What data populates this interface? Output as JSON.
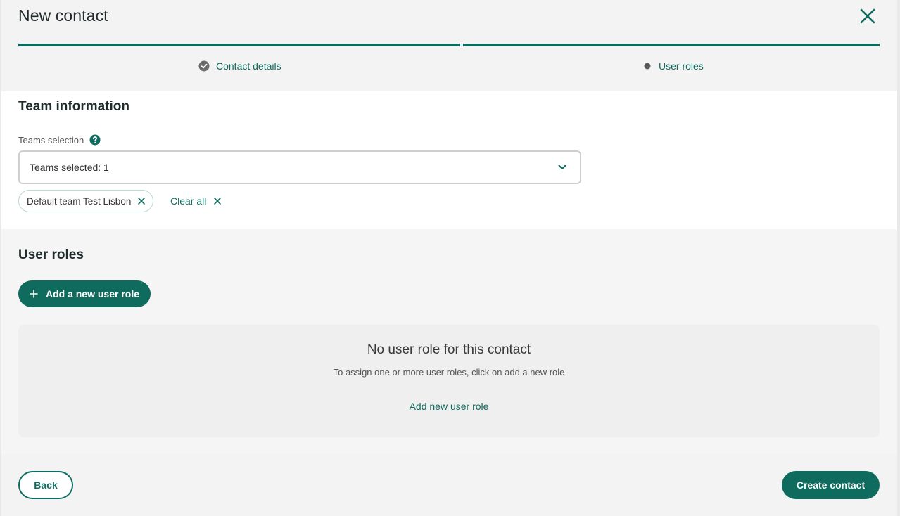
{
  "header": {
    "title": "New contact",
    "close_icon": "close-icon"
  },
  "stepper": {
    "steps": [
      {
        "label": "Contact details",
        "status": "completed",
        "icon": "check-circle-icon"
      },
      {
        "label": "User roles",
        "status": "current",
        "icon": "dot-icon"
      }
    ]
  },
  "team_information": {
    "title": "Team information",
    "teams_label": "Teams selection",
    "help_icon": "help-icon",
    "select_value": "Teams selected: 1",
    "chips": [
      {
        "label": "Default team Test Lisbon"
      }
    ],
    "clear_all_label": "Clear all"
  },
  "user_roles": {
    "title": "User roles",
    "add_button_label": "Add a new user role",
    "empty_title": "No user role for this contact",
    "empty_subtitle": "To assign one or more user roles, click on add a new role",
    "empty_link": "Add new user role"
  },
  "footer": {
    "back_label": "Back",
    "create_label": "Create contact"
  },
  "colors": {
    "accent": "#0e6b5e",
    "background": "#f3f3f3",
    "panel": "#ffffff"
  }
}
